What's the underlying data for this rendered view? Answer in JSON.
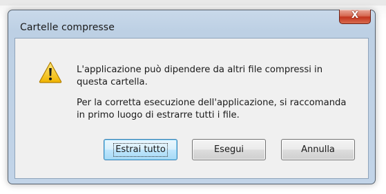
{
  "dialog": {
    "title": "Cartelle compresse",
    "close_glyph": "X",
    "icon": "warning-icon",
    "message_line_1": "L'applicazione può dipendere da altri file compressi in questa cartella.",
    "message_line_2": "Per la corretta esecuzione dell'applicazione, si raccomanda in primo luogo di estrarre tutti i file."
  },
  "buttons": {
    "extract_all": "Estrai tutto",
    "run": "Esegui",
    "cancel": "Annulla"
  },
  "colors": {
    "frame": "#c2d4e8",
    "content_bg": "#f0f0f0",
    "close_button": "#c2351e",
    "default_button_border": "#3c7fb1",
    "warning_yellow": "#f4c41a"
  }
}
